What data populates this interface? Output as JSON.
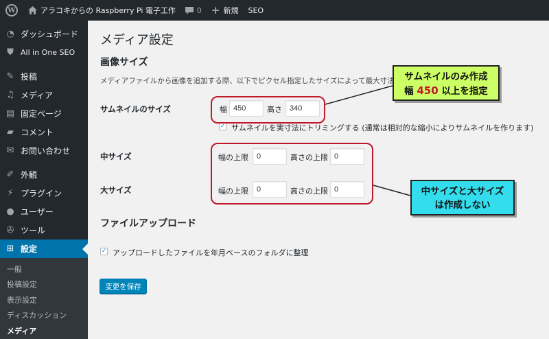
{
  "adminbar": {
    "site_name": "アラコキからの Raspberry Pi 電子工作",
    "comments_count": "0",
    "new_label": "新規",
    "seo_label": "SEO"
  },
  "sidebar": {
    "items": [
      {
        "label": "ダッシュボード",
        "icon": "dashboard-icon"
      },
      {
        "label": "All in One SEO",
        "icon": "seo-shield-icon"
      },
      {
        "label": "投稿",
        "icon": "pin-icon"
      },
      {
        "label": "メディア",
        "icon": "media-icon"
      },
      {
        "label": "固定ページ",
        "icon": "page-icon"
      },
      {
        "label": "コメント",
        "icon": "comment-icon"
      },
      {
        "label": "お問い合わせ",
        "icon": "mail-icon"
      },
      {
        "label": "外観",
        "icon": "brush-icon"
      },
      {
        "label": "プラグイン",
        "icon": "plugin-icon"
      },
      {
        "label": "ユーザー",
        "icon": "user-icon"
      },
      {
        "label": "ツール",
        "icon": "wrench-icon"
      },
      {
        "label": "設定",
        "icon": "settings-icon"
      }
    ],
    "submenu": [
      "一般",
      "投稿設定",
      "表示設定",
      "ディスカッション",
      "メディア"
    ]
  },
  "main": {
    "title": "メディア設定",
    "image_sizes_heading": "画像サイズ",
    "description": "メディアファイルから画像を追加する際、以下でピクセル指定したサイズによって最大寸法",
    "thumbnail": {
      "label": "サムネイルのサイズ",
      "width_label": "幅",
      "width": "450",
      "height_label": "高さ",
      "height": "340",
      "crop_label": "サムネイルを実寸法にトリミングする (通常は相対的な縮小によりサムネイルを作ります)",
      "crop_checked": true
    },
    "medium": {
      "label": "中サイズ",
      "max_width_label": "幅の上限",
      "max_width": "0",
      "max_height_label": "高さの上限",
      "max_height": "0"
    },
    "large": {
      "label": "大サイズ",
      "max_width_label": "幅の上限",
      "max_width": "0",
      "max_height_label": "高さの上限",
      "max_height": "0"
    },
    "uploads_heading": "ファイルアップロード",
    "organize_label": "アップロードしたファイルを年月ベースのフォルダに整理",
    "organize_checked": true,
    "save_label": "変更を保存"
  },
  "annotations": {
    "note1_line1": "サムネイルのみ作成",
    "note1_line2_pre": "幅",
    "note1_value": "450",
    "note1_line2_post": "以上を指定",
    "note2_line1": "中サイズと大サイズ",
    "note2_line2": "は作成しない",
    "note1_bg": "#ccff66",
    "note2_bg": "#33ddee",
    "highlight_color": "#c0182c"
  },
  "colors": {
    "adminbar_bg": "#23282d",
    "current_menu_bg": "#0073aa",
    "primary_button": "#0085ba"
  },
  "check_glyph": "✓"
}
